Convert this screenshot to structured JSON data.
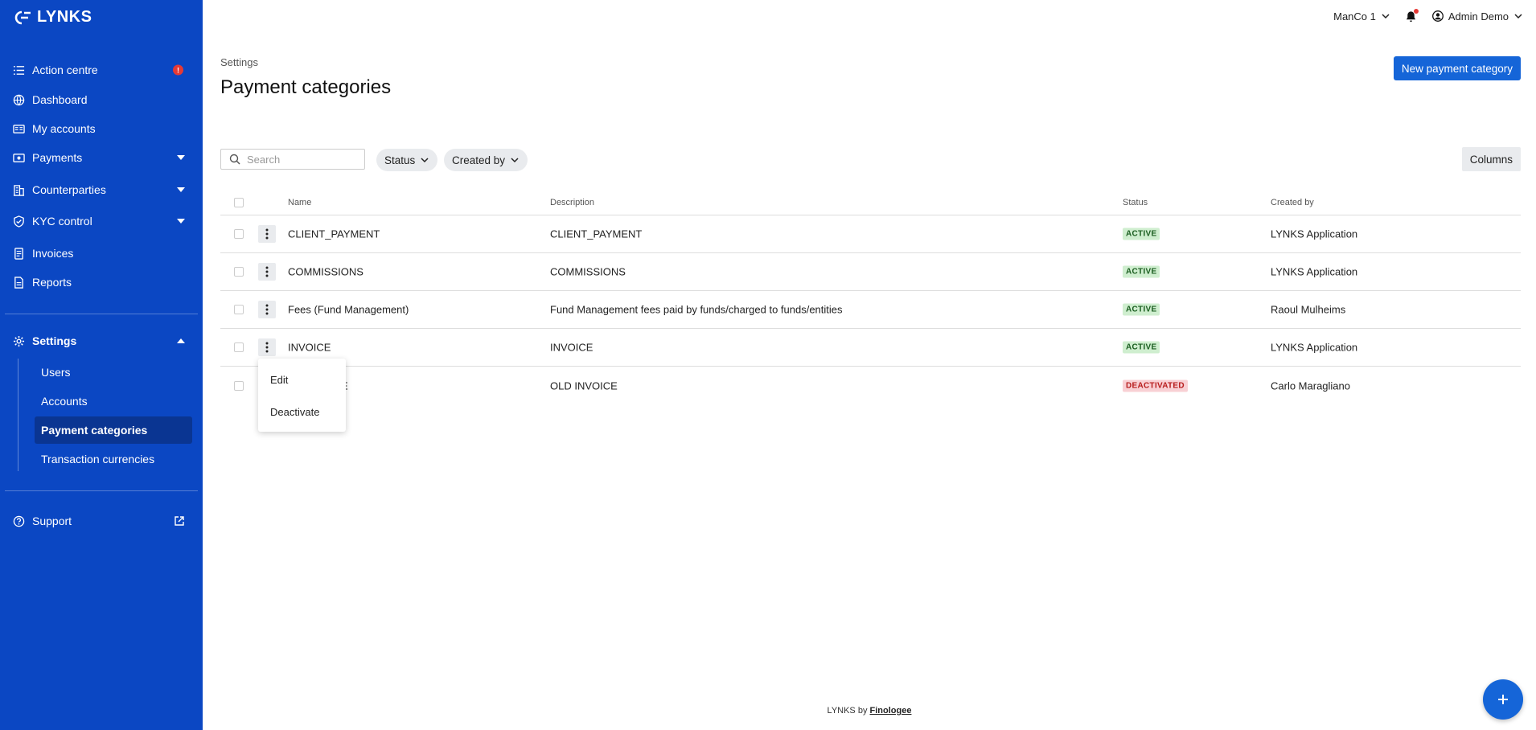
{
  "app": {
    "logo_text": "LYNKS"
  },
  "sidebar": {
    "items": [
      {
        "label": "Action centre",
        "icon": "list-check-icon",
        "badge": "!"
      },
      {
        "label": "Dashboard",
        "icon": "globe-icon"
      },
      {
        "label": "My accounts",
        "icon": "accounts-icon"
      },
      {
        "label": "Payments",
        "icon": "payments-icon"
      },
      {
        "label": "Counterparties",
        "icon": "building-icon"
      },
      {
        "label": "KYC control",
        "icon": "shield-check-icon"
      },
      {
        "label": "Invoices",
        "icon": "invoice-icon"
      },
      {
        "label": "Reports",
        "icon": "report-icon"
      },
      {
        "label": "Settings",
        "icon": "gear-icon"
      },
      {
        "label": "Support",
        "icon": "help-icon"
      }
    ],
    "settings_sub": [
      "Users",
      "Accounts",
      "Payment categories",
      "Transaction currencies"
    ]
  },
  "topbar": {
    "company": "ManCo 1",
    "user": "Admin Demo"
  },
  "page": {
    "breadcrumb": "Settings",
    "title": "Payment categories",
    "new_button": "New payment category"
  },
  "filters": {
    "search_placeholder": "Search",
    "status": "Status",
    "created_by": "Created by",
    "columns": "Columns"
  },
  "table": {
    "headers": {
      "name": "Name",
      "description": "Description",
      "status": "Status",
      "created_by": "Created by"
    },
    "rows": [
      {
        "name": "CLIENT_PAYMENT",
        "description": "CLIENT_PAYMENT",
        "status": "ACTIVE",
        "created_by": "LYNKS Application"
      },
      {
        "name": "COMMISSIONS",
        "description": "COMMISSIONS",
        "status": "ACTIVE",
        "created_by": "LYNKS Application"
      },
      {
        "name": "Fees (Fund Management)",
        "description": "Fund Management fees paid by funds/charged to funds/entities",
        "status": "ACTIVE",
        "created_by": "Raoul Mulheims"
      },
      {
        "name": "INVOICE",
        "description": "INVOICE",
        "status": "ACTIVE",
        "created_by": "LYNKS Application"
      },
      {
        "name": "E",
        "description": "OLD INVOICE",
        "status": "DEACTIVATED",
        "created_by": "Carlo Maragliano"
      }
    ]
  },
  "row_menu": {
    "edit": "Edit",
    "deactivate": "Deactivate"
  },
  "footer": {
    "prefix": "LYNKS by",
    "link": "Finologee"
  },
  "colors": {
    "sidebar": "#0b47c3",
    "primary": "#1565d8",
    "active_badge": "#cfeecf",
    "deactivated_badge": "#f8d0d4"
  }
}
